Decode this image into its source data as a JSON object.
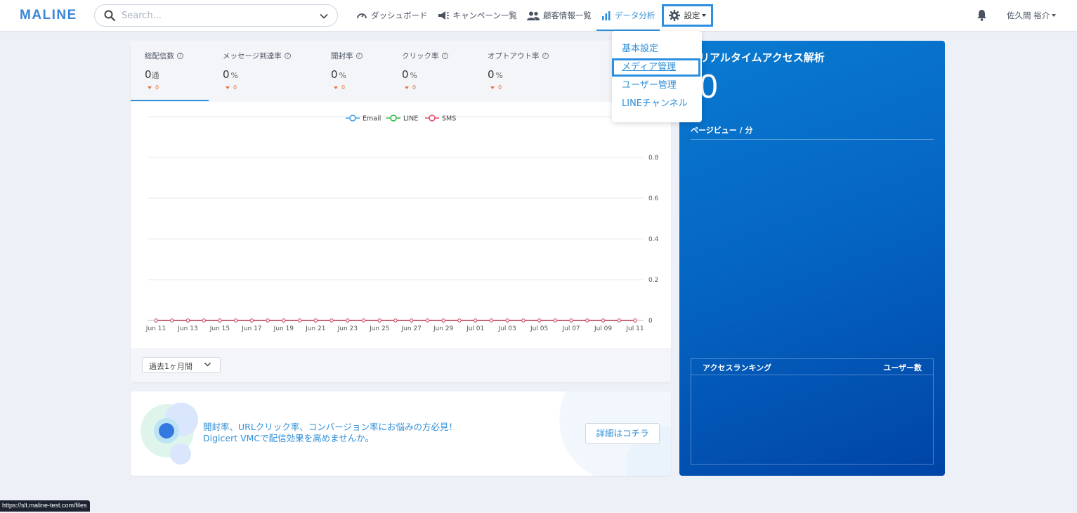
{
  "header": {
    "logo": "MALINE",
    "search_placeholder": "Search...",
    "nav": [
      {
        "label": "ダッシュボード",
        "icon": "dashboard-icon"
      },
      {
        "label": "キャンペーン一覧",
        "icon": "megaphone-icon"
      },
      {
        "label": "顧客情報一覧",
        "icon": "people-icon"
      },
      {
        "label": "データ分析",
        "icon": "bar-chart-icon",
        "active": true
      },
      {
        "label": "設定",
        "icon": "gear-icon"
      }
    ],
    "user_name": "佐久間 裕介"
  },
  "settings_menu": {
    "items": [
      {
        "label": "基本設定"
      },
      {
        "label": "メディア管理",
        "active": true
      },
      {
        "label": "ユーザー管理"
      },
      {
        "label": "LINEチャンネル"
      }
    ]
  },
  "stats": [
    {
      "label": "総配信数",
      "value": "0",
      "unit": "通",
      "delta": "0"
    },
    {
      "label": "メッセージ到達率",
      "value": "0",
      "unit": "%",
      "delta": "0"
    },
    {
      "label": "開封率",
      "value": "0",
      "unit": "%",
      "delta": "0"
    },
    {
      "label": "クリック率",
      "value": "0",
      "unit": "%",
      "delta": "0"
    },
    {
      "label": "オプトアウト率",
      "value": "0",
      "unit": "%",
      "delta": "0"
    }
  ],
  "period_select": "過去1ヶ月間",
  "chart_data": {
    "type": "line",
    "x": [
      "Jun 11",
      "Jun 12",
      "Jun 13",
      "Jun 14",
      "Jun 15",
      "Jun 16",
      "Jun 17",
      "Jun 18",
      "Jun 19",
      "Jun 20",
      "Jun 21",
      "Jun 22",
      "Jun 23",
      "Jun 24",
      "Jun 25",
      "Jun 26",
      "Jun 27",
      "Jun 28",
      "Jun 29",
      "Jun 30",
      "Jul 01",
      "Jul 02",
      "Jul 03",
      "Jul 04",
      "Jul 05",
      "Jul 06",
      "Jul 07",
      "Jul 08",
      "Jul 09",
      "Jul 10",
      "Jul 11"
    ],
    "x_tick_labels": [
      "Jun 11",
      "Jun 13",
      "Jun 15",
      "Jun 17",
      "Jun 19",
      "Jun 21",
      "Jun 23",
      "Jun 25",
      "Jun 27",
      "Jun 29",
      "Jul 01",
      "Jul 03",
      "Jul 05",
      "Jul 07",
      "Jul 09",
      "Jul 11"
    ],
    "series": [
      {
        "name": "Email",
        "color": "#3aa0e8",
        "values": [
          0,
          0,
          0,
          0,
          0,
          0,
          0,
          0,
          0,
          0,
          0,
          0,
          0,
          0,
          0,
          0,
          0,
          0,
          0,
          0,
          0,
          0,
          0,
          0,
          0,
          0,
          0,
          0,
          0,
          0,
          0
        ]
      },
      {
        "name": "LINE",
        "color": "#28b93b",
        "values": [
          0,
          0,
          0,
          0,
          0,
          0,
          0,
          0,
          0,
          0,
          0,
          0,
          0,
          0,
          0,
          0,
          0,
          0,
          0,
          0,
          0,
          0,
          0,
          0,
          0,
          0,
          0,
          0,
          0,
          0,
          0
        ]
      },
      {
        "name": "SMS",
        "color": "#e8486a",
        "values": [
          0,
          0,
          0,
          0,
          0,
          0,
          0,
          0,
          0,
          0,
          0,
          0,
          0,
          0,
          0,
          0,
          0,
          0,
          0,
          0,
          0,
          0,
          0,
          0,
          0,
          0,
          0,
          0,
          0,
          0,
          0
        ]
      }
    ],
    "y_ticks": [
      "0",
      "0.2",
      "0.4",
      "0.6",
      "0.8"
    ],
    "ylim": [
      0,
      1
    ],
    "legend": "top-center",
    "grid": true
  },
  "promo": {
    "line1": "開封率、URLクリック率、コンバージョン率にお悩みの方必見！",
    "line2": "Digicert VMCで配信効果を高めませんか。",
    "button": "詳細はコチラ"
  },
  "realtime": {
    "title": "リアルタイムアクセス解析",
    "value": "0",
    "subtitle": "ページビュー / 分",
    "ranking_title": "アクセスランキング",
    "ranking_col": "ユーザー数"
  },
  "status_url": "https://slt.maline-test.com/files"
}
